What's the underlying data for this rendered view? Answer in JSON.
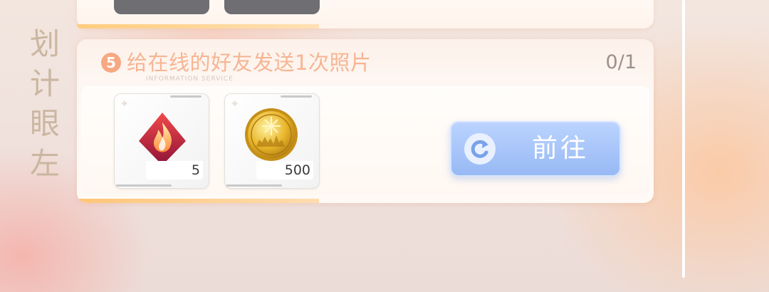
{
  "side_title": [
    "划",
    "计",
    "眼",
    "左"
  ],
  "task": {
    "number": "5",
    "text": "给在线的好友发送1次照片",
    "progress": "0/1",
    "sublabel": "INFORMATION SERVICE"
  },
  "rewards": [
    {
      "icon": "flame-crystal-icon",
      "quantity": "5"
    },
    {
      "icon": "gold-coin-icon",
      "quantity": "500"
    }
  ],
  "go_button": {
    "label": "前往",
    "icon": "refresh-arrow-icon"
  },
  "colors": {
    "badge": "#f7a882",
    "task_text": "#f6b592",
    "button": "#96b8f4",
    "accent_bar": "#ffc67a"
  }
}
